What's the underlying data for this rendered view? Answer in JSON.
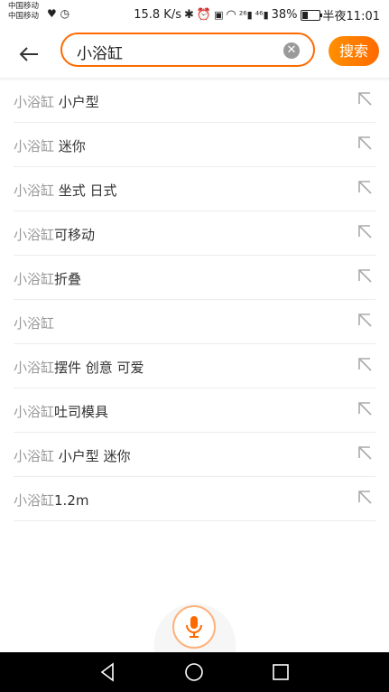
{
  "status_bar": {
    "carrier1": "中国移动",
    "carrier2": "中国移动",
    "speed": "15.8 K/s",
    "signal1": "²⁶",
    "signal2": "⁴⁶",
    "battery": "38%",
    "battery_level": 0.38,
    "time": "半夜11:01"
  },
  "search": {
    "query": "小浴缸",
    "button_label": "搜索"
  },
  "suggestions": [
    {
      "keyword": "小浴缸",
      "rest": " 小户型"
    },
    {
      "keyword": "小浴缸",
      "rest": " 迷你"
    },
    {
      "keyword": "小浴缸",
      "rest": " 坐式 日式"
    },
    {
      "keyword": "小浴缸",
      "rest": "可移动"
    },
    {
      "keyword": "小浴缸",
      "rest": "折叠"
    },
    {
      "keyword": "小浴缸",
      "rest": ""
    },
    {
      "keyword": "小浴缸",
      "rest": "摆件 创意 可爱"
    },
    {
      "keyword": "小浴缸",
      "rest": "吐司模具"
    },
    {
      "keyword": "小浴缸",
      "rest": " 小户型 迷你"
    },
    {
      "keyword": "小浴缸",
      "rest": "1.2m"
    }
  ],
  "icons": {
    "back": "arrow-left-icon",
    "clear": "clear-icon",
    "fill": "arrow-up-left-icon",
    "voice": "microphone-icon"
  },
  "colors": {
    "accent": "#ff6a00",
    "keyword": "#999999",
    "text": "#333333"
  }
}
